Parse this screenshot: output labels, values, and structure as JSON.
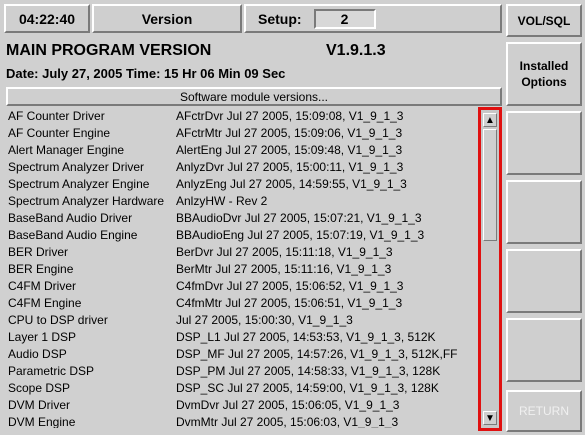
{
  "topbar": {
    "time": "04:22:40",
    "version_label": "Version",
    "setup_label": "Setup:",
    "setup_value": "2"
  },
  "header": {
    "title": "MAIN PROGRAM VERSION",
    "version": "V1.9.1.3",
    "date_line": "Date: July 27, 2005  Time: 15 Hr 06 Min 09 Sec"
  },
  "list_header": "Software module versions...",
  "modules": [
    {
      "name": "AF Counter Driver",
      "info": "AFctrDvr Jul 27 2005, 15:09:08,  V1_9_1_3"
    },
    {
      "name": "AF Counter Engine",
      "info": "AFctrMtr Jul 27 2005, 15:09:06,  V1_9_1_3"
    },
    {
      "name": "Alert Manager Engine",
      "info": "AlertEng Jul 27 2005, 15:09:48,  V1_9_1_3"
    },
    {
      "name": "Spectrum Analyzer Driver",
      "info": "AnlyzDvr Jul 27 2005, 15:00:11,  V1_9_1_3"
    },
    {
      "name": "Spectrum Analyzer Engine",
      "info": "AnlyzEng Jul 27 2005, 14:59:55,  V1_9_1_3"
    },
    {
      "name": "Spectrum Analyzer Hardware",
      "info": "AnlzyHW - Rev 2"
    },
    {
      "name": "BaseBand Audio Driver",
      "info": "BBAudioDvr Jul 27 2005, 15:07:21,  V1_9_1_3"
    },
    {
      "name": "BaseBand Audio Engine",
      "info": "BBAudioEng Jul 27 2005, 15:07:19,  V1_9_1_3"
    },
    {
      "name": "BER Driver",
      "info": "BerDvr Jul 27 2005, 15:11:18,  V1_9_1_3"
    },
    {
      "name": "BER Engine",
      "info": "BerMtr Jul 27 2005, 15:11:16,  V1_9_1_3"
    },
    {
      "name": "C4FM Driver",
      "info": "C4fmDvr Jul 27 2005, 15:06:52,  V1_9_1_3"
    },
    {
      "name": "C4FM Engine",
      "info": "C4fmMtr Jul 27 2005, 15:06:51,  V1_9_1_3"
    },
    {
      "name": "CPU to DSP driver",
      "info": "Jul 27 2005, 15:00:30, V1_9_1_3"
    },
    {
      "name": "Layer 1 DSP",
      "info": "DSP_L1 Jul 27 2005, 14:53:53, V1_9_1_3, 512K"
    },
    {
      "name": "Audio DSP",
      "info": "DSP_MF Jul 27 2005, 14:57:26, V1_9_1_3, 512K,FF"
    },
    {
      "name": "Parametric DSP",
      "info": "DSP_PM Jul 27 2005, 14:58:33, V1_9_1_3, 128K"
    },
    {
      "name": "Scope DSP",
      "info": "DSP_SC Jul 27 2005, 14:59:00, V1_9_1_3, 128K"
    },
    {
      "name": "DVM Driver",
      "info": "DvmDvr Jul 27 2005, 15:06:05,  V1_9_1_3"
    },
    {
      "name": "DVM Engine",
      "info": "DvmMtr Jul 27 2005, 15:06:03,  V1_9_1_3"
    }
  ],
  "scrollbar": {
    "up_icon": "arrow-up-icon",
    "down_icon": "arrow-down-icon",
    "highlight_color": "#e01010"
  },
  "side_buttons": {
    "vol_sql": "VOL/SQL",
    "installed_options": "Installed Options",
    "returns": "RETURN"
  }
}
